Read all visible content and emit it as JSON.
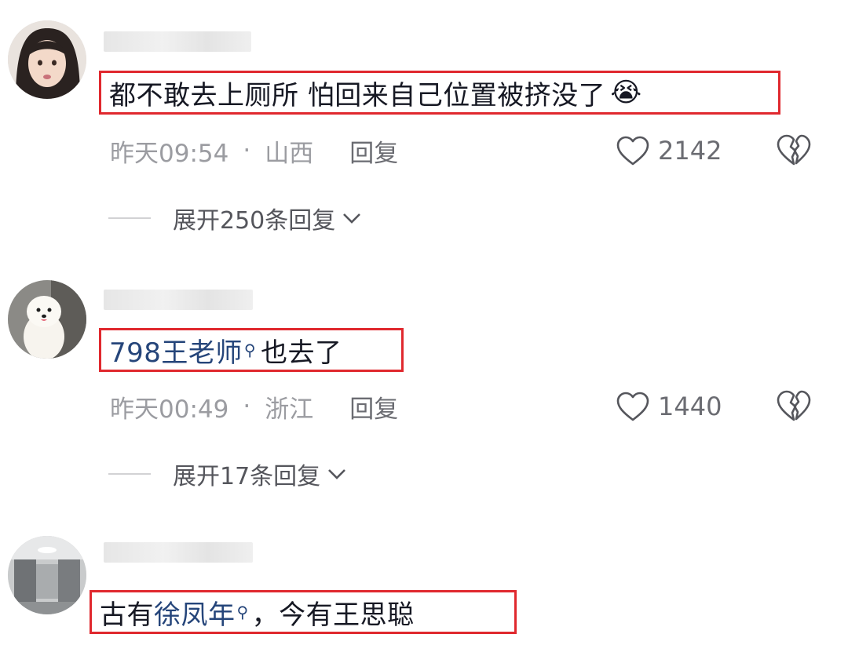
{
  "comments": [
    {
      "username_blurred": "",
      "text": "都不敢去上厕所 怕回来自己位置被挤没了",
      "emoji": "😭",
      "time": "昨天09:54",
      "dot": "·",
      "location": "山西",
      "reply_label": "回复",
      "likes": "2142",
      "expand_label": "展开250条回复"
    },
    {
      "username_blurred": "",
      "mention": "798王老师",
      "text_after": "也去了",
      "time": "昨天00:49",
      "dot": "·",
      "location": "浙江",
      "reply_label": "回复",
      "likes": "1440",
      "expand_label": "展开17条回复"
    },
    {
      "username_blurred": "",
      "text_before": "古有",
      "mention": "徐凤年",
      "text_after": "，今有王思聪"
    }
  ],
  "icons": {
    "like": "heart-outline-icon",
    "dislike": "broken-heart-icon",
    "expand": "chevron-down-icon",
    "mention_search": "search-icon"
  },
  "colors": {
    "highlight_border": "#e0282e",
    "mention": "#25457a",
    "meta_text": "#9b9ca1"
  }
}
